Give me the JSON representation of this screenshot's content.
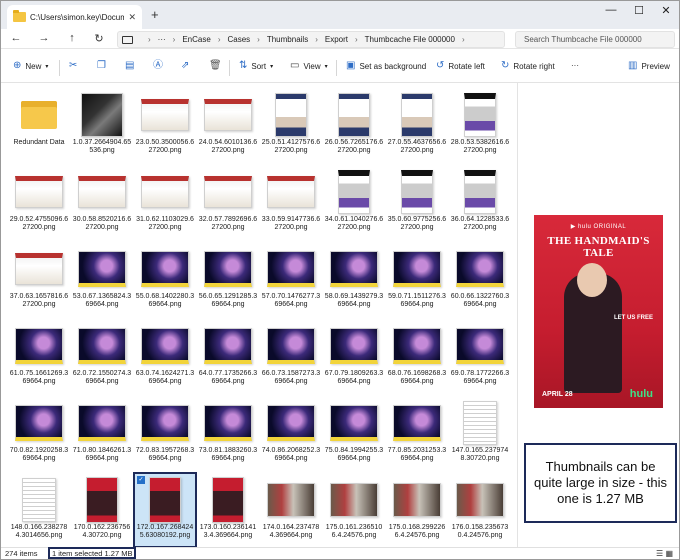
{
  "titlebar": {
    "tab_title": "C:\\Users\\simon.key\\Document",
    "tab_close": "✕",
    "new_tab": "+",
    "minimize": "—",
    "maximize": "☐",
    "close": "✕"
  },
  "nav": {
    "back": "←",
    "forward": "→",
    "up": "↑",
    "refresh": "↻"
  },
  "breadcrumb": {
    "more": "···",
    "items": [
      "EnCase",
      "Cases",
      "Thumbnails",
      "Export",
      "Thumbcache File 000000"
    ],
    "separator": "›"
  },
  "search": {
    "placeholder": "Search Thumbcache File 000000"
  },
  "toolbar": {
    "new_label": "New",
    "sort_label": "Sort",
    "view_label": "View",
    "set_background_label": "Set as background",
    "rotate_left_label": "Rotate left",
    "rotate_right_label": "Rotate right",
    "more_label": "···",
    "preview_label": "Preview"
  },
  "files": [
    {
      "name": "Redundant Data",
      "kind": "folder"
    },
    {
      "name": "1.0.37.2664904.65536.png",
      "kind": "dark"
    },
    {
      "name": "23.0.50.3500056.627200.png",
      "kind": "id"
    },
    {
      "name": "24.0.54.6010136.627200.png",
      "kind": "id"
    },
    {
      "name": "25.0.51.4127576.627200.png",
      "kind": "badge"
    },
    {
      "name": "26.0.56.7265176.627200.png",
      "kind": "badge"
    },
    {
      "name": "27.0.55.4637656.627200.png",
      "kind": "badge"
    },
    {
      "name": "28.0.53.5382616.627200.png",
      "kind": "press"
    },
    {
      "name": "29.0.52.4755096.627200.png",
      "kind": "id"
    },
    {
      "name": "30.0.58.8520216.627200.png",
      "kind": "id"
    },
    {
      "name": "31.0.62.1103029.627200.png",
      "kind": "id"
    },
    {
      "name": "32.0.57.7892696.627200.png",
      "kind": "id"
    },
    {
      "name": "33.0.59.9147736.627200.png",
      "kind": "id"
    },
    {
      "name": "34.0.61.1040276.627200.png",
      "kind": "press"
    },
    {
      "name": "35.0.60.9775256.627200.png",
      "kind": "press"
    },
    {
      "name": "36.0.64.1228533.627200.png",
      "kind": "press"
    },
    {
      "name": "37.0.63.1657816.627200.png",
      "kind": "id"
    },
    {
      "name": "53.0.67.1365824.369664.png",
      "kind": "space"
    },
    {
      "name": "55.0.68.1402280.369664.png",
      "kind": "space"
    },
    {
      "name": "56.0.65.1291285.369664.png",
      "kind": "space"
    },
    {
      "name": "57.0.70.1476277.369664.png",
      "kind": "space"
    },
    {
      "name": "58.0.69.1439279.369664.png",
      "kind": "space"
    },
    {
      "name": "59.0.71.1511276.369664.png",
      "kind": "space"
    },
    {
      "name": "60.0.66.1322760.369664.png",
      "kind": "space"
    },
    {
      "name": "61.0.75.1661269.369664.png",
      "kind": "space"
    },
    {
      "name": "62.0.72.1550274.369664.png",
      "kind": "space"
    },
    {
      "name": "63.0.74.1624271.369664.png",
      "kind": "space"
    },
    {
      "name": "64.0.77.1735266.369664.png",
      "kind": "space"
    },
    {
      "name": "66.0.73.1587273.369664.png",
      "kind": "space"
    },
    {
      "name": "67.0.79.1809263.369664.png",
      "kind": "space"
    },
    {
      "name": "68.0.76.1698268.369664.png",
      "kind": "space"
    },
    {
      "name": "69.0.78.1772266.369664.png",
      "kind": "space"
    },
    {
      "name": "70.0.82.1920258.369664.png",
      "kind": "space"
    },
    {
      "name": "71.0.80.1846261.369664.png",
      "kind": "space"
    },
    {
      "name": "72.0.83.1957268.369664.png",
      "kind": "space"
    },
    {
      "name": "73.0.81.1883260.369664.png",
      "kind": "space"
    },
    {
      "name": "74.0.86.2068252.369664.png",
      "kind": "space"
    },
    {
      "name": "75.0.84.1994255.369664.png",
      "kind": "space"
    },
    {
      "name": "77.0.85.2031253.369664.png",
      "kind": "space"
    },
    {
      "name": "147.0.165.2379748.30720.png",
      "kind": "doc"
    },
    {
      "name": "148.0.166.2382784.3014656.png",
      "kind": "doc"
    },
    {
      "name": "170.0.162.2367564.30720.png",
      "kind": "poster"
    },
    {
      "name": "172.0.167.2684245.63080192.png",
      "kind": "poster",
      "selected": true
    },
    {
      "name": "173.0.160.2361413.4.369664.png",
      "kind": "poster"
    },
    {
      "name": "174.0.164.2374784.369664.png",
      "kind": "scene"
    },
    {
      "name": "175.0.161.2365106.4.24576.png",
      "kind": "scene"
    },
    {
      "name": "175.0.168.2992266.4.24576.png",
      "kind": "scene"
    },
    {
      "name": "176.0.158.2356730.4.24576.png",
      "kind": "scene"
    }
  ],
  "preview": {
    "hulu_original": "▶ hulu ORIGINAL",
    "title": "THE HANDMAID'S TALE",
    "tagline": "LET US FREE",
    "date": "APRIL 28",
    "brand": "hulu"
  },
  "callout": "Thumbnails can be quite large in size - this one is 1.27 MB",
  "status": {
    "count": "274 items",
    "selection": "1 item selected  1.27 MB",
    "view_icons": "☰ ▦"
  },
  "colors": {
    "accent": "#2e6dc6",
    "selection_bg": "#cce4f7",
    "highlight_border": "#1d2a59",
    "poster_red": "#c51d2f"
  }
}
